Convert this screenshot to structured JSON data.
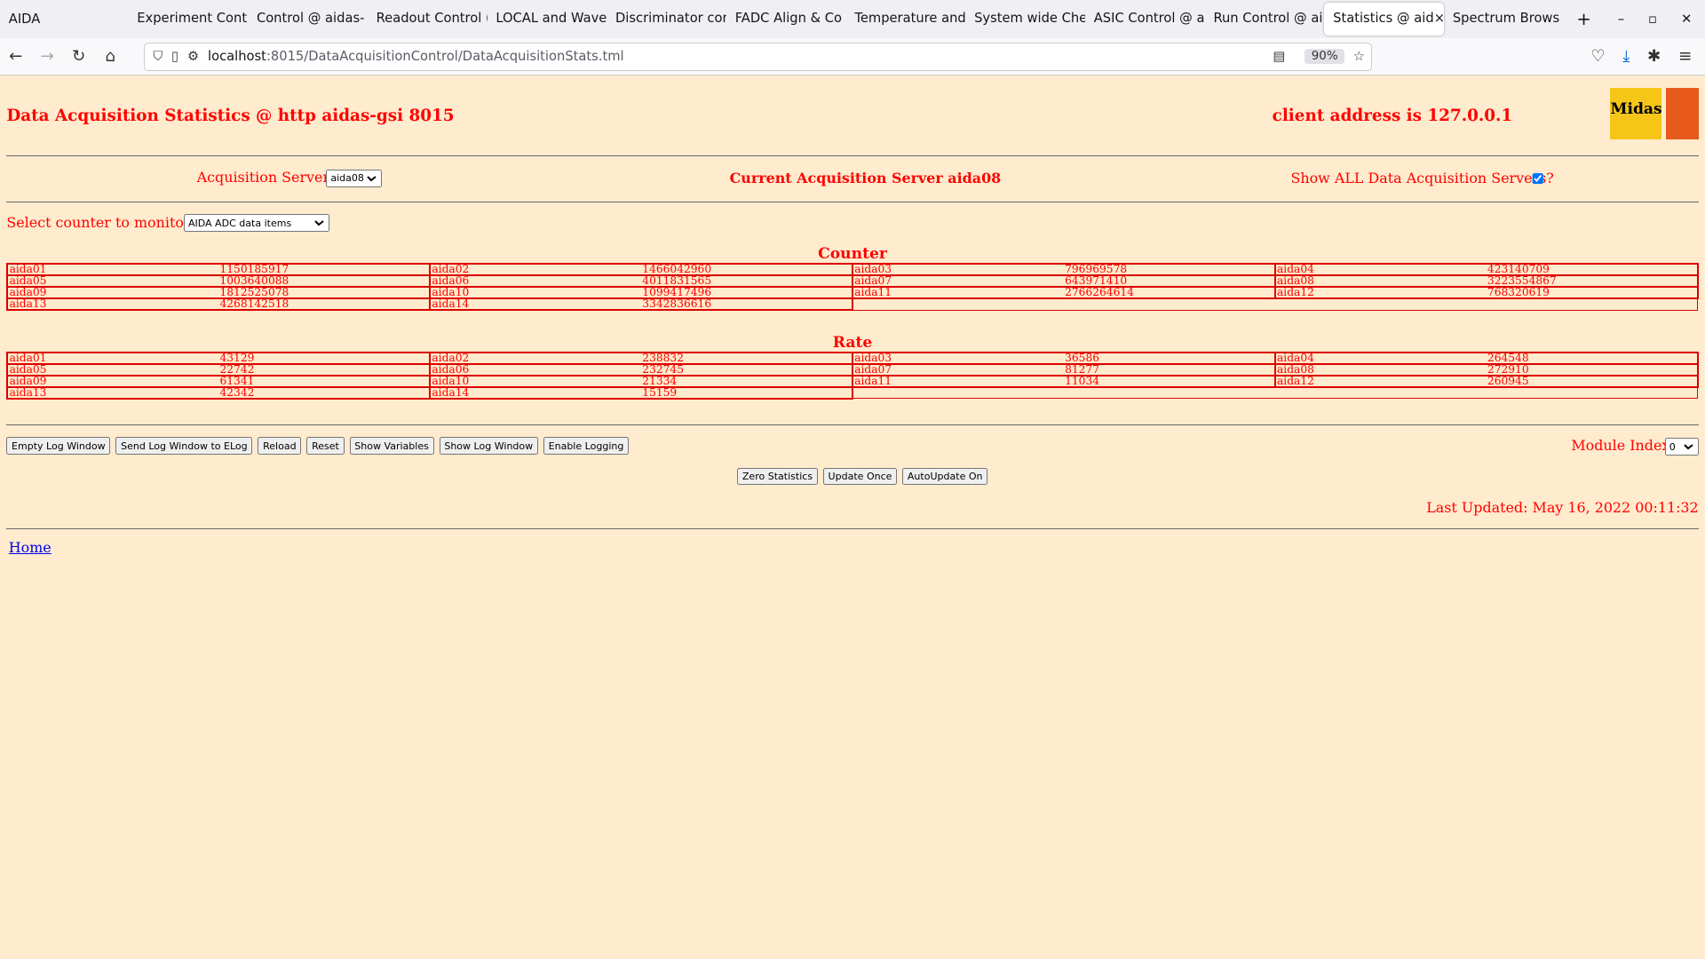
{
  "browser": {
    "app_title": "AIDA",
    "tabs": [
      "Experiment Contr",
      "Control @ aidas-",
      "Readout Control (",
      "LOCAL and Wave",
      "Discriminator con",
      "FADC Align & Co",
      "Temperature and",
      "System wide Che",
      "ASIC Control @ a",
      "Run Control @ ai",
      "Statistics @ aid",
      "Spectrum Brows"
    ],
    "active_tab": 10,
    "url_host": "localhost",
    "url_path": ":8015/DataAcquisitionControl/DataAcquisitionStats.tml",
    "zoom": "90%"
  },
  "header": {
    "title": "Data Acquisition Statistics @ http aidas-gsi 8015",
    "client": "client address is 127.0.0.1",
    "logo_text": "Midas"
  },
  "servers": {
    "label": "Acquisition Servers",
    "selected": "aida08",
    "current": "Current Acquisition Server aida08",
    "show_all": "Show ALL Data Acquisition Servers?",
    "show_all_checked": true
  },
  "counter_select": {
    "label": "Select counter to monitor",
    "selected": "AIDA ADC data items"
  },
  "counter": {
    "title": "Counter",
    "rows": [
      [
        [
          "aida01",
          "1150185917"
        ],
        [
          "aida02",
          "1466042960"
        ],
        [
          "aida03",
          "796969578"
        ],
        [
          "aida04",
          "423140709"
        ]
      ],
      [
        [
          "aida05",
          "1003640088"
        ],
        [
          "aida06",
          "4011831565"
        ],
        [
          "aida07",
          "643971410"
        ],
        [
          "aida08",
          "3223554867"
        ]
      ],
      [
        [
          "aida09",
          "1812525078"
        ],
        [
          "aida10",
          "1099417496"
        ],
        [
          "aida11",
          "2766264614"
        ],
        [
          "aida12",
          "768320619"
        ]
      ],
      [
        [
          "aida13",
          "4268142518"
        ],
        [
          "aida14",
          "3342836616"
        ]
      ]
    ]
  },
  "rate": {
    "title": "Rate",
    "rows": [
      [
        [
          "aida01",
          "43129"
        ],
        [
          "aida02",
          "238832"
        ],
        [
          "aida03",
          "36586"
        ],
        [
          "aida04",
          "264548"
        ]
      ],
      [
        [
          "aida05",
          "22742"
        ],
        [
          "aida06",
          "232745"
        ],
        [
          "aida07",
          "81277"
        ],
        [
          "aida08",
          "272910"
        ]
      ],
      [
        [
          "aida09",
          "61341"
        ],
        [
          "aida10",
          "21334"
        ],
        [
          "aida11",
          "11034"
        ],
        [
          "aida12",
          "260945"
        ]
      ],
      [
        [
          "aida13",
          "42342"
        ],
        [
          "aida14",
          "15159"
        ]
      ]
    ]
  },
  "buttons": [
    "Empty Log Window",
    "Send Log Window to ELog",
    "Reload",
    "Reset",
    "Show Variables",
    "Show Log Window",
    "Enable Logging"
  ],
  "module_index": {
    "label": "Module Index",
    "selected": "0"
  },
  "buttons2": [
    "Zero Statistics",
    "Update Once",
    "AutoUpdate On"
  ],
  "last_updated": "Last Updated: May 16, 2022 00:11:32",
  "home_link": "Home"
}
